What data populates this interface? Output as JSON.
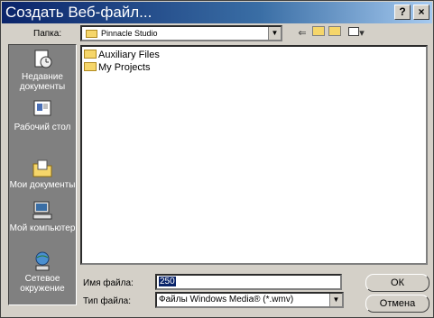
{
  "window": {
    "title": "Создать Веб-файл...",
    "help_label": "?",
    "close_label": "×"
  },
  "toolbar": {
    "lookin_label": "Папка:",
    "lookin_value": "Pinnacle Studio",
    "back_icon": "back-arrow-icon",
    "up_icon": "up-folder-icon",
    "newfolder_icon": "new-folder-icon",
    "views_icon": "views-menu-icon"
  },
  "places": [
    {
      "label": "Недавние документы",
      "icon": "recent-documents-icon"
    },
    {
      "label": "Рабочий стол",
      "icon": "desktop-icon"
    },
    {
      "label": "Мои документы",
      "icon": "my-documents-icon"
    },
    {
      "label": "Мой компьютер",
      "icon": "my-computer-icon"
    },
    {
      "label": "Сетевое окружение",
      "icon": "network-places-icon"
    }
  ],
  "files": [
    {
      "name": "Auxiliary Files"
    },
    {
      "name": "My Projects"
    }
  ],
  "form": {
    "filename_label": "Имя файла:",
    "filename_value": "250",
    "filetype_label": "Тип файла:",
    "filetype_value": "Файлы Windows Media® (*.wmv)"
  },
  "buttons": {
    "ok_label": "ОК",
    "cancel_label": "Отмена"
  }
}
